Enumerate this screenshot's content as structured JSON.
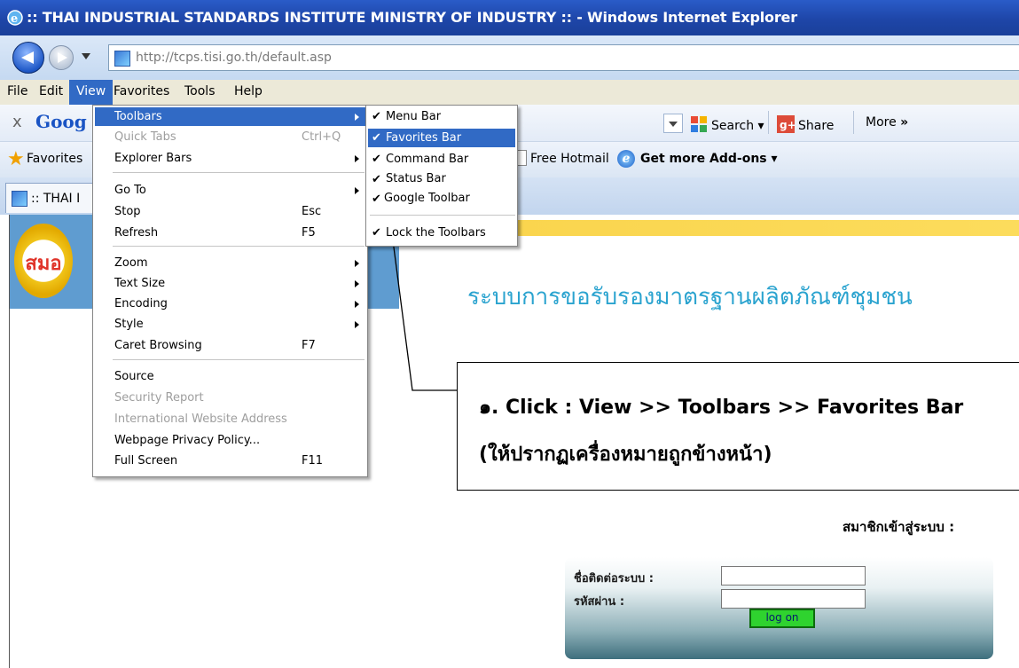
{
  "window": {
    "title": ":: THAI INDUSTRIAL STANDARDS INSTITUTE MINISTRY OF INDUSTRY :: - Windows Internet Explorer"
  },
  "address": {
    "url": "http://tcps.tisi.go.th/default.asp"
  },
  "menubar": {
    "file": "File",
    "edit": "Edit",
    "view": "View",
    "favorites": "Favorites",
    "tools": "Tools",
    "help": "Help"
  },
  "google_toolbar": {
    "close": "x",
    "logo": "Goog",
    "search": "Search",
    "share": "Share",
    "more": "More"
  },
  "favorites_bar": {
    "label": "Favorites",
    "hotmail": "Free Hotmail",
    "addons": "Get more Add-ons"
  },
  "tab": {
    "label": ":: THAI I"
  },
  "view_menu": {
    "toolbars": "Toolbars",
    "quick_tabs": "Quick Tabs",
    "quick_tabs_shortcut": "Ctrl+Q",
    "explorer_bars": "Explorer Bars",
    "go_to": "Go To",
    "stop": "Stop",
    "stop_shortcut": "Esc",
    "refresh": "Refresh",
    "refresh_shortcut": "F5",
    "zoom": "Zoom",
    "text_size": "Text Size",
    "encoding": "Encoding",
    "style": "Style",
    "caret_browsing": "Caret Browsing",
    "caret_shortcut": "F7",
    "source": "Source",
    "security_report": "Security Report",
    "intl_address": "International Website Address",
    "privacy_policy": "Webpage Privacy Policy...",
    "full_screen": "Full Screen",
    "full_screen_shortcut": "F11"
  },
  "toolbars_menu": {
    "menu_bar": "Menu Bar",
    "favorites_bar": "Favorites Bar",
    "command_bar": "Command Bar",
    "status_bar": "Status Bar",
    "google_toolbar": "Google Toolbar",
    "lock_toolbars": "Lock the Toolbars"
  },
  "page": {
    "logo_text": "สมอ",
    "heading": "ระบบการขอรับรองมาตรฐานผลิตภัณฑ์ชุมชน",
    "member_label": "สมาชิกเข้าสู่ระบบ :",
    "login": {
      "username_label": "ชื่อติดต่อระบบ :",
      "password_label": "รหัสผ่าน :",
      "button": "log on"
    }
  },
  "annotation": {
    "line1": "๑. Click : View >> Toolbars >> Favorites Bar",
    "line2": "(ให้ปรากฏเครื่องหมายถูกข้างหน้า)"
  },
  "colors": {
    "menu_highlight": "#316ac5",
    "title_bar": "#1e46a8",
    "heading_text": "#2aa3cf"
  }
}
